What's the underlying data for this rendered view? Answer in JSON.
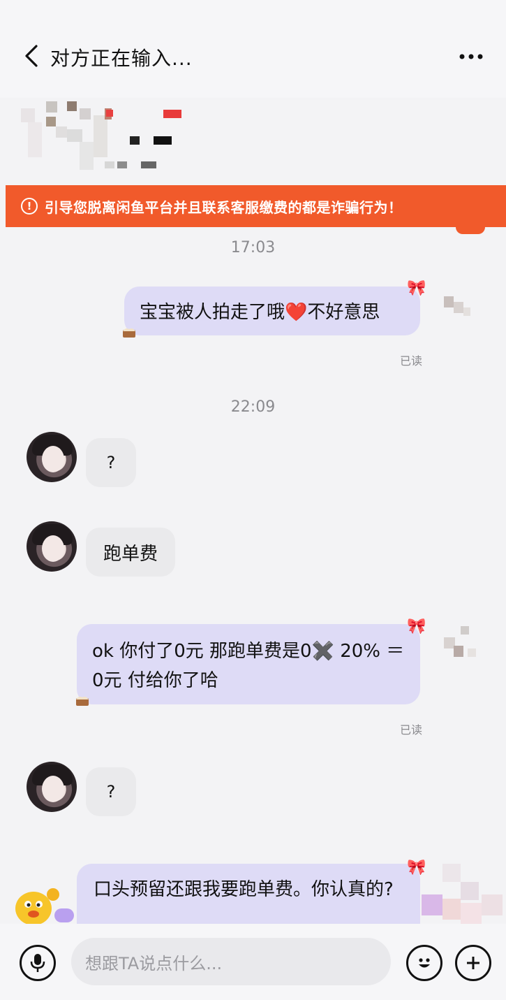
{
  "header": {
    "title": "对方正在输入..."
  },
  "warning": {
    "icon": "!",
    "text": "引导您脱离闲鱼平台并且联系客服缴费的都是诈骗行为！"
  },
  "messages": {
    "ts1": "17:03",
    "m1_text": "宝宝被人拍走了哦❤️不好意思",
    "m1_status": "已读",
    "ts2": "22:09",
    "m2_text": "?",
    "m3_text": "跑单费",
    "m4_text": "ok 你付了0元 那跑单费是0✖️ 20% ＝ 0元 付给你了哈",
    "m4_status": "已读",
    "m5_text": "?",
    "m6_text": "口头预留还跟我要跑单费。你认真的?"
  },
  "input": {
    "placeholder": "想跟TA说点什么..."
  },
  "colors": {
    "warning_bg": "#f15a2b",
    "outgoing_bubble": "#dedbf6",
    "incoming_bubble": "#eaeaec"
  }
}
